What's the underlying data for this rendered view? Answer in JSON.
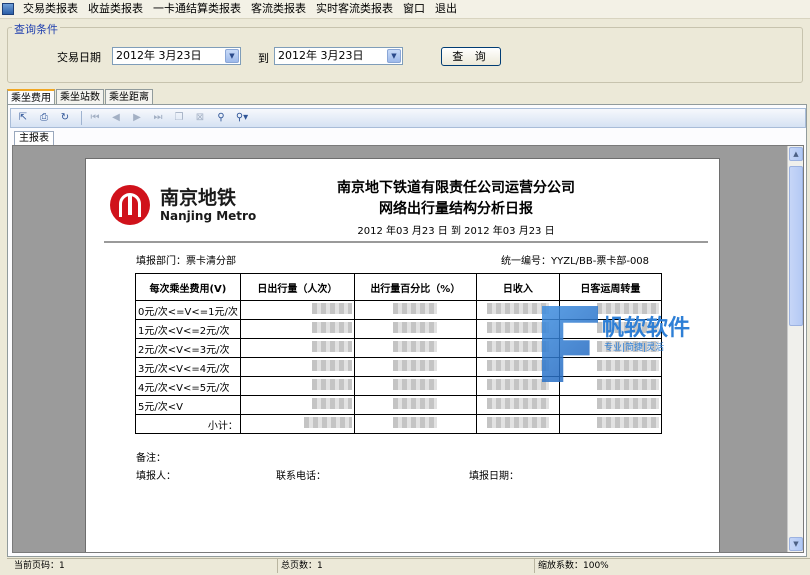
{
  "menu": [
    "交易类报表",
    "收益类报表",
    "一卡通结算类报表",
    "客流类报表",
    "实时客流类报表",
    "窗口",
    "退出"
  ],
  "query": {
    "group_title": "查询条件",
    "date_label": "交易日期",
    "from_date": "2012年 3月23日",
    "to_label": "到",
    "to_date": "2012年 3月23日",
    "query_button": "查 询"
  },
  "tabs": [
    "乘坐费用",
    "乘坐站数",
    "乘坐距离"
  ],
  "active_tab": 0,
  "viewer": {
    "subtab": "主报表"
  },
  "report": {
    "logo_cn": "南京地铁",
    "logo_en": "Nanjing Metro",
    "title1": "南京地下铁道有限责任公司运营分公司",
    "title2": "网络出行量结构分析日报",
    "date_range": "2012 年03 月23 日 到 2012 年03 月23 日",
    "dept": "填报部门：票卡清分部",
    "code": "统一编号：YYZL/BB-票卡部-008",
    "columns": [
      "每次乘坐费用(V)",
      "日出行量（人次）",
      "出行量百分比（%）",
      "日收入",
      "日客运周转量"
    ],
    "rows": [
      "0元/次<=V<=1元/次",
      "1元/次<V<=2元/次",
      "2元/次<V<=3元/次",
      "3元/次<V<=4元/次",
      "4元/次<V<=5元/次",
      "5元/次<V"
    ],
    "subtotal": "小计：",
    "remark": "备注：",
    "reporter": "填报人：",
    "phone": "联系电话：",
    "report_date": "填报日期："
  },
  "watermark": {
    "name": "帆软软件",
    "slogan": "专业|简捷|灵活"
  },
  "status": {
    "page": "当前页码：1",
    "total": "总页数：1",
    "zoom": "缩放系数：100%"
  }
}
